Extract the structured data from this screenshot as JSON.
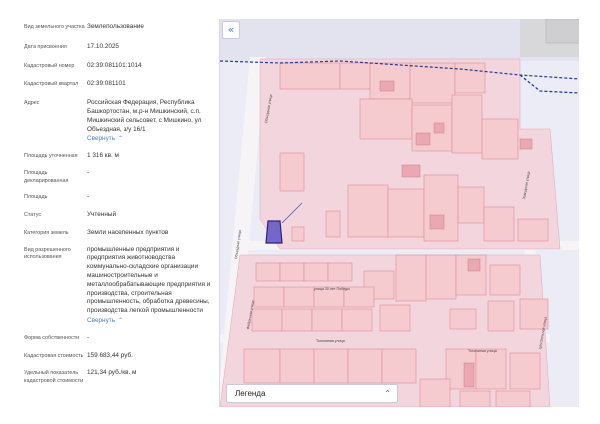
{
  "info": {
    "rows": [
      {
        "label": "Вид земельного участка",
        "value": "Землепользование"
      },
      {
        "label": "Дата присвоения",
        "value": "17.10.2025"
      },
      {
        "label": "Кадастровый номер",
        "value": "02:39:081101:1014"
      },
      {
        "label": "Кадастровый квартал",
        "value": "02:39:081101"
      },
      {
        "label": "Адрес",
        "value": "Российская Федерация, Республика Башкортостан, м.р-н Мишкинский, с.п. Мишкинский сельсовет, с Мишкино, ул Объездная, з/у 16/1",
        "more": "Свернуть"
      },
      {
        "label": "Площадь уточненная",
        "value": "1 316 кв. м"
      },
      {
        "label": "Площадь декларированная",
        "value": "-"
      },
      {
        "label": "Площадь",
        "value": "-"
      },
      {
        "label": "Статус",
        "value": "Учтенный"
      },
      {
        "label": "Категория земель",
        "value": "Земли населенных пунктов"
      },
      {
        "label": "Вид разрешенного использования",
        "value": "промышленные предприятия и предприятия животноводства коммунально-складские организации машиностроительные и металлообрабатывающие предприятия и производства, строительная промышленность, обработка древесины, производства легкой промышленности",
        "more": "Свернуть"
      },
      {
        "label": "Форма собственности",
        "value": "-"
      },
      {
        "label": "Кадастровая стоимость",
        "value": "159 683,44 руб."
      },
      {
        "label": "Удельный показатель кадастровой стоимости",
        "value": "121,34 руб./кв. м"
      }
    ]
  },
  "map": {
    "collapse_icon": "«",
    "legend_label": "Легенда",
    "legend_chevron": "⌃⌄",
    "streets": [
      "Объездная улица",
      "Объездная улица",
      "Фабричная улица",
      "улица 30 лет Победы",
      "Тополиная улица",
      "Тополиная улица",
      "Заводская улица",
      "Центральная улица"
    ],
    "parcel_fill": "#f6cbd0",
    "parcel_stroke": "#df8c94",
    "selected_fill": "#7566c9",
    "boundary_color": "#1e3c8c"
  }
}
